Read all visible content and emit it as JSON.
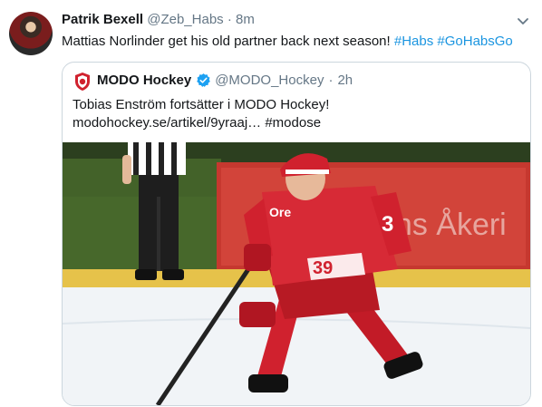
{
  "tweet": {
    "display_name": "Patrik Bexell",
    "handle": "@Zeb_Habs",
    "separator": "·",
    "time": "8m",
    "text_plain": "Mattias Norlinder get his old partner back next season! ",
    "hashtag_1": "#Habs",
    "hashtag_2": "#GoHabsGo"
  },
  "quoted": {
    "display_name": "MODO Hockey",
    "handle": "@MODO_Hockey",
    "separator": "·",
    "time": "2h",
    "line_1": "Tobias Enström fortsätter i MODO Hockey!",
    "line_2_link": "modohockey.se/artikel/9yraaj…",
    "line_2_hashtag": "#modose",
    "photo": {
      "banner_text": "ans Åkeri",
      "jersey_number": "39",
      "jersey_sponsor": "Ore",
      "sleeve_number": "3"
    }
  },
  "colors": {
    "link": "#1b95e0",
    "muted": "#657786",
    "verified": "#1da1f2",
    "modo_red": "#d0212e"
  },
  "icons": {
    "menu": "chevron-down-icon",
    "verified": "verified-badge-icon",
    "logo": "modo-logo-icon"
  }
}
